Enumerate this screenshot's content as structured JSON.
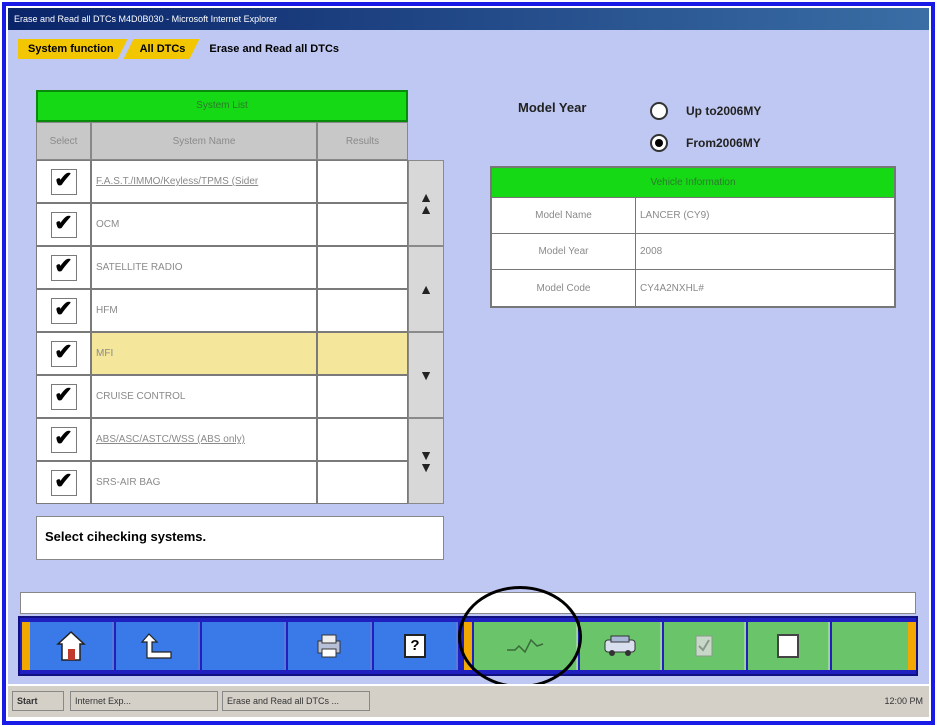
{
  "window": {
    "title": "Erase and Read all DTCs M4D0B030 - Microsoft Internet Explorer"
  },
  "breadcrumb": [
    "System function",
    "All DTCs",
    "Erase and Read all DTCs"
  ],
  "system_list": {
    "title": "System List",
    "columns": [
      "Select",
      "System Name",
      "Results"
    ],
    "rows": [
      {
        "checked": "✔",
        "name": "F.A.S.T./IMMO/Keyless/TPMS (Sider",
        "underline": true
      },
      {
        "checked": "✔",
        "name": "OCM",
        "underline": false
      },
      {
        "checked": "✔",
        "name": "SATELLITE RADIO",
        "underline": false
      },
      {
        "checked": "✔",
        "name": "HFM",
        "underline": false
      },
      {
        "checked": "✔",
        "name": "MFI",
        "underline": false
      },
      {
        "checked": "✔",
        "name": "CRUISE CONTROL",
        "underline": false
      },
      {
        "checked": "✔",
        "name": "ABS/ASC/ASTC/WSS (ABS only)",
        "underline": true
      },
      {
        "checked": "✔",
        "name": "SRS-AIR BAG",
        "underline": false
      }
    ]
  },
  "status_message": "Select cihecking systems.",
  "model_year": {
    "label": "Model Year",
    "options": [
      {
        "label": "Up to2006MY",
        "selected": false
      },
      {
        "label": "From2006MY",
        "selected": true
      }
    ]
  },
  "vehicle_info": {
    "title": "Vehicle Information",
    "rows": [
      {
        "key": "Model Name",
        "value": "LANCER (CY9)"
      },
      {
        "key": "Model Year",
        "value": "2008"
      },
      {
        "key": "Model Code",
        "value": "CY4A2NXHL#"
      }
    ]
  },
  "toolbar": {
    "help_label": "?"
  },
  "taskbar": {
    "start": "Start",
    "items": [
      "Internet Exp...",
      "Erase and Read all DTCs ..."
    ],
    "tray": "12:00 PM"
  },
  "colors": {
    "header_green": "#16d916",
    "crumb_yellow": "#f2c600",
    "toolbar_blue": "#2020c0",
    "highlight": "#f4e69a"
  }
}
